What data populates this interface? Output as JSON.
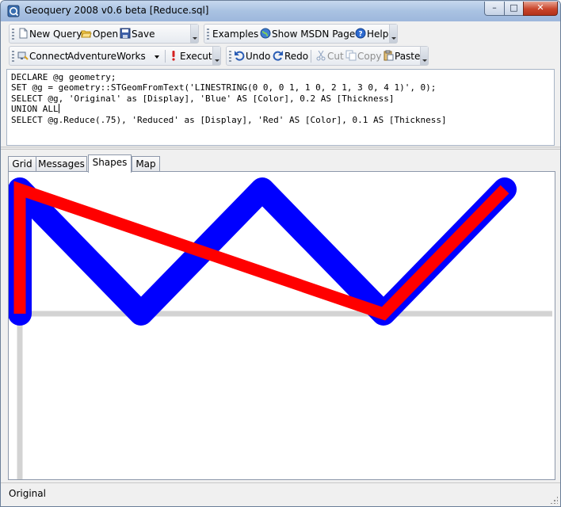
{
  "window": {
    "title": "Geoquery 2008 v0.6 beta [Reduce.sql]",
    "controls": {
      "minimize": "–",
      "maximize": "□",
      "close": "✕"
    }
  },
  "toolbar": {
    "new_query": "New Query",
    "open": "Open",
    "save": "Save",
    "examples": "Examples",
    "show_msdn": "Show MSDN Page",
    "help": "Help",
    "connect": "Connect",
    "database": "AdventureWorks",
    "execute": "Execute",
    "undo": "Undo",
    "redo": "Redo",
    "cut": "Cut",
    "copy": "Copy",
    "paste": "Paste"
  },
  "editor": {
    "lines": [
      "DECLARE @g geometry;",
      "SET @g = geometry::STGeomFromText('LINESTRING(0 0, 0 1, 1 0, 2 1, 3 0, 4 1)', 0);",
      "SELECT @g, 'Original' as [Display], 'Blue' AS [Color], 0.2 AS [Thickness]",
      "UNION ALL",
      "SELECT @g.Reduce(.75), 'Reduced' as [Display], 'Red' AS [Color], 0.1 AS [Thickness]"
    ]
  },
  "tabs": [
    {
      "label": "Grid"
    },
    {
      "label": "Messages"
    },
    {
      "label": "Shapes"
    },
    {
      "label": "Map"
    }
  ],
  "active_tab": "Shapes",
  "shapes": {
    "original": {
      "points": [
        [
          0,
          0
        ],
        [
          0,
          1
        ],
        [
          1,
          0
        ],
        [
          2,
          1
        ],
        [
          3,
          0
        ],
        [
          4,
          1
        ]
      ],
      "color": "#0000ff",
      "thickness": 0.2
    },
    "reduced": {
      "points": [
        [
          0,
          0
        ],
        [
          0,
          1
        ],
        [
          3,
          0
        ],
        [
          4,
          1
        ]
      ],
      "color": "#ff0000",
      "thickness": 0.1
    }
  },
  "status": {
    "text": "Original"
  },
  "colors": {
    "accent": "#3f74c4",
    "title_bar": "#a9c2e2"
  }
}
